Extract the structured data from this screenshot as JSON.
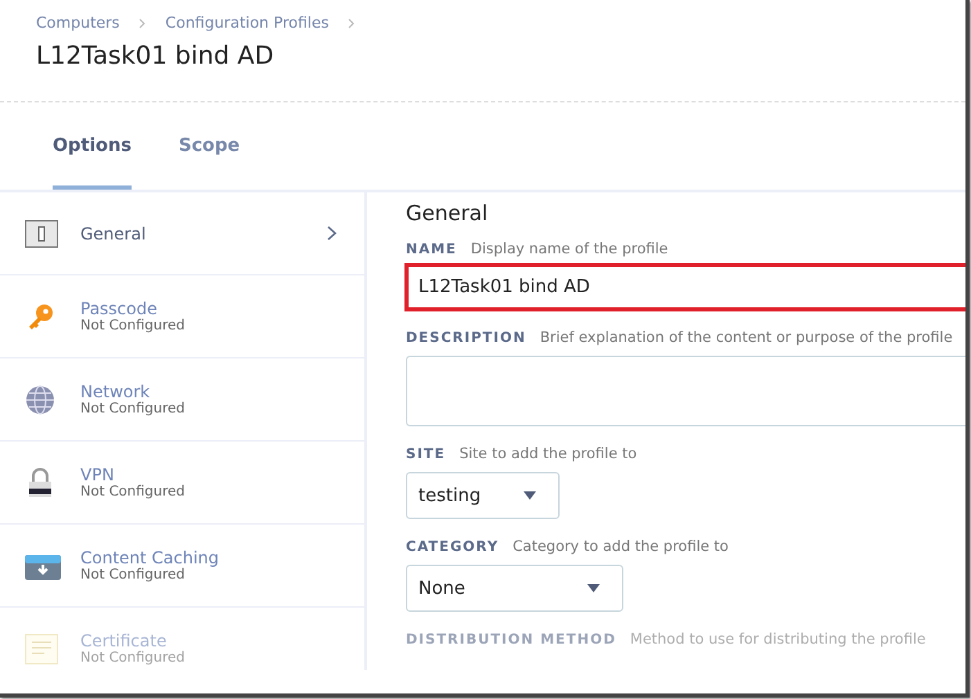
{
  "breadcrumb": [
    "Computers",
    "Configuration Profiles"
  ],
  "title": "L12Task01 bind AD",
  "tabs": [
    {
      "label": "Options",
      "selected": true
    },
    {
      "label": "Scope",
      "selected": false
    }
  ],
  "sidebar": {
    "items": [
      {
        "kind": "switch",
        "label": "General",
        "selected": true,
        "faded": false
      },
      {
        "kind": "key",
        "label": "Passcode",
        "status": "Not Configured",
        "selected": false,
        "faded": false
      },
      {
        "kind": "globe",
        "label": "Network",
        "status": "Not Configured",
        "selected": false,
        "faded": false
      },
      {
        "kind": "lock",
        "label": "VPN",
        "status": "Not Configured",
        "selected": false,
        "faded": false
      },
      {
        "kind": "box",
        "label": "Content Caching",
        "status": "Not Configured",
        "selected": false,
        "faded": false
      },
      {
        "kind": "certificate",
        "label": "Certificate",
        "status": "Not Configured",
        "selected": false,
        "faded": true
      }
    ]
  },
  "panel": {
    "heading": "General",
    "fields": [
      {
        "kind": "text",
        "label": "NAME",
        "hint": "Display name of the profile",
        "value": "L12Task01 bind AD",
        "highlighted": true,
        "faded": false
      },
      {
        "kind": "textarea",
        "label": "DESCRIPTION",
        "hint": "Brief explanation of the content or purpose of the profile",
        "faded": false
      },
      {
        "kind": "select",
        "label": "SITE",
        "hint": "Site to add the profile to",
        "value": "testing",
        "faded": false
      },
      {
        "kind": "select",
        "label": "CATEGORY",
        "hint": "Category to add the profile to",
        "value": "None",
        "faded": false
      },
      {
        "kind": "label",
        "label": "DISTRIBUTION METHOD",
        "hint": "Method to use for distributing the profile",
        "faded": true
      }
    ]
  }
}
